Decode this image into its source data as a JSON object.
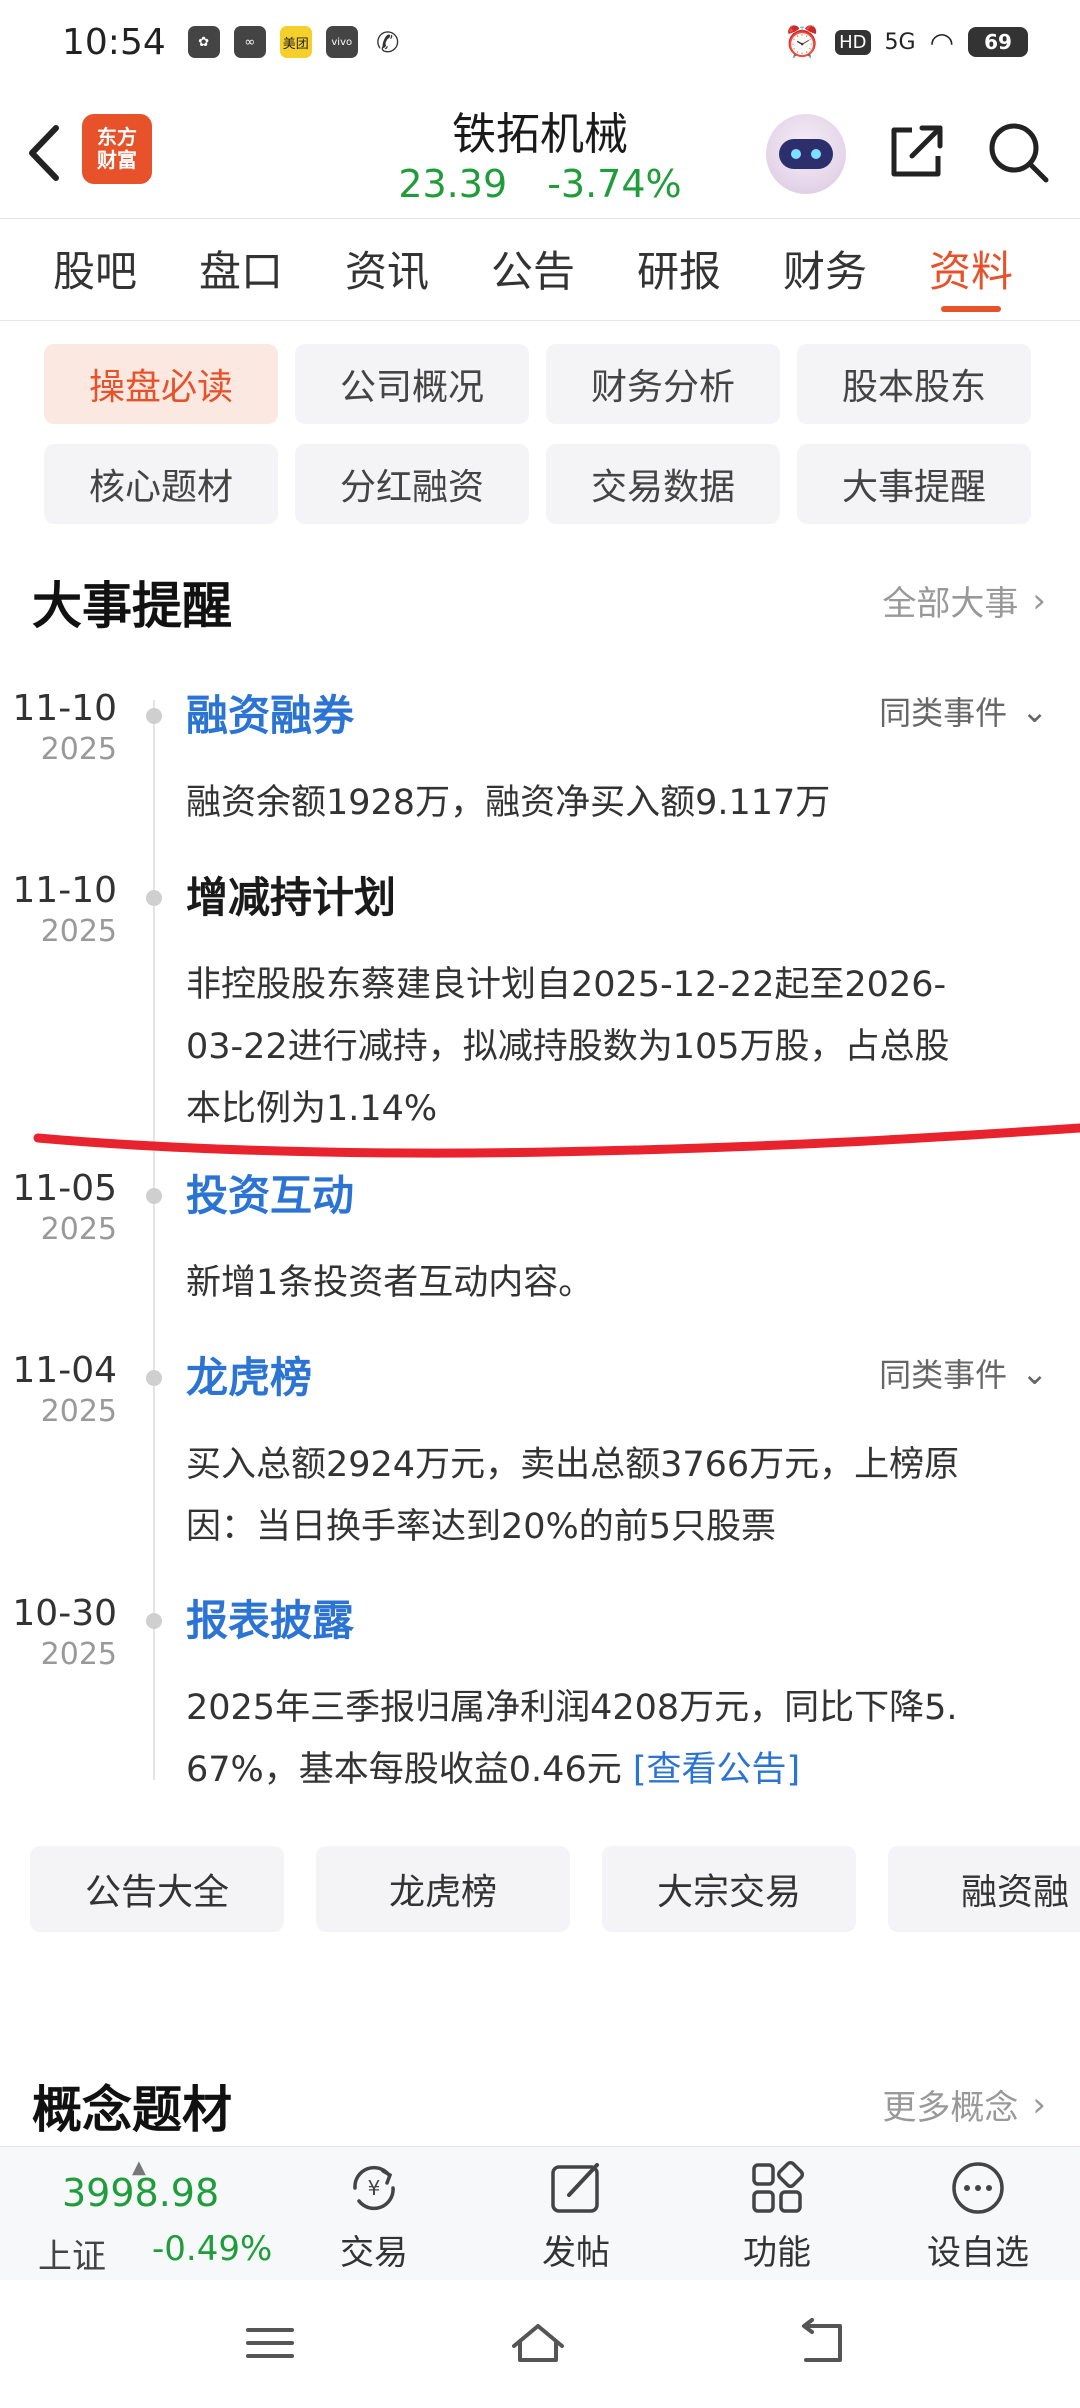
{
  "status_bar": {
    "time": "10:54",
    "left_icons": [
      "app-icon",
      "app-icon",
      "meituan-icon",
      "vivo-icon",
      "phone-icon"
    ],
    "meituan_label": "美团",
    "vivo_label": "vivo",
    "hd_label": "HD",
    "network_label": "5G",
    "battery": "69"
  },
  "header": {
    "logo_line1": "东方",
    "logo_line2": "财富",
    "stock_name": "铁拓机械",
    "price": "23.39",
    "change_pct": "-3.74%",
    "price_color": "#1f9d3a"
  },
  "tabs": [
    {
      "label": "股吧"
    },
    {
      "label": "盘口"
    },
    {
      "label": "资讯"
    },
    {
      "label": "公告"
    },
    {
      "label": "研报"
    },
    {
      "label": "财务"
    },
    {
      "label": "资料",
      "active": true
    }
  ],
  "sub_chips": [
    {
      "label": "操盘必读",
      "active": true
    },
    {
      "label": "公司概况"
    },
    {
      "label": "财务分析"
    },
    {
      "label": "股本股东"
    },
    {
      "label": "核心题材"
    },
    {
      "label": "分红融资"
    },
    {
      "label": "交易数据"
    },
    {
      "label": "大事提醒"
    }
  ],
  "events_section": {
    "title": "大事提醒",
    "more_label": "全部大事"
  },
  "events": [
    {
      "date": "11-10",
      "year": "2025",
      "title": "融资融券",
      "same_label": "同类事件",
      "desc": "融资余额1928万，融资净买入额9.117万"
    },
    {
      "date": "11-10",
      "year": "2025",
      "title": "增减持计划",
      "desc_line1": "非控股股东蔡建良计划自2025-12-22起至2026-",
      "desc_line2": "03-22进行减持，拟减持股数为105万股，占总股",
      "desc_line3": "本比例为1.14%"
    },
    {
      "date": "11-05",
      "year": "2025",
      "title": "投资互动",
      "desc": "新增1条投资者互动内容。"
    },
    {
      "date": "11-04",
      "year": "2025",
      "title": "龙虎榜",
      "same_label": "同类事件",
      "desc_line1": "买入总额2924万元，卖出总额3766万元，上榜原",
      "desc_line2": "因：当日换手率达到20%的前5只股票"
    },
    {
      "date": "10-30",
      "year": "2025",
      "title": "报表披露",
      "desc_line1": "2025年三季报归属净利润4208万元，同比下降5.",
      "desc_line2": "67%，基本每股收益0.46元",
      "link_label": "[查看公告]"
    }
  ],
  "quick_chips": [
    {
      "label": "公告大全"
    },
    {
      "label": "龙虎榜"
    },
    {
      "label": "大宗交易"
    },
    {
      "label": "融资融"
    }
  ],
  "concept_section": {
    "title": "概念题材",
    "more_label": "更多概念"
  },
  "bottom_nav": {
    "index_value": "3998.98",
    "index_name": "上证",
    "index_change": "-0.49%",
    "items": [
      {
        "label": "交易",
        "icon": "yen-refresh-icon"
      },
      {
        "label": "发帖",
        "icon": "edit-post-icon"
      },
      {
        "label": "功能",
        "icon": "grid-apps-icon"
      },
      {
        "label": "设自选",
        "icon": "more-dots-icon"
      }
    ]
  },
  "colors": {
    "accent": "#e8522a",
    "link": "#2b74d4",
    "down": "#1f9d3a"
  }
}
